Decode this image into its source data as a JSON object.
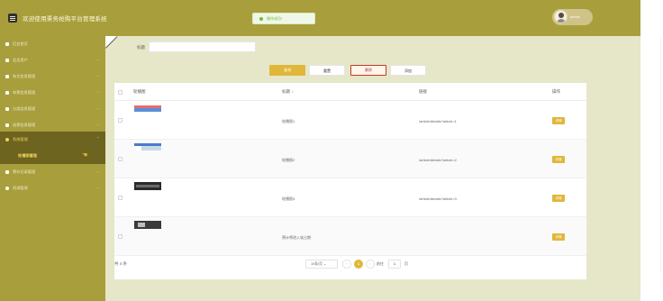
{
  "header": {
    "title": "欢迎使用票务抢购平台管理系统",
    "toast": "操作成功!",
    "user": "admin"
  },
  "sidebar": {
    "items": [
      {
        "label": "后台首页"
      },
      {
        "label": "会员用户"
      },
      {
        "label": "车次信息管理"
      },
      {
        "label": "车票信息管理"
      },
      {
        "label": "分类信息管理"
      },
      {
        "label": "退票信息管理"
      },
      {
        "label": "系统管理"
      },
      {
        "label": "轮播图管理"
      },
      {
        "label": "票价记录管理"
      },
      {
        "label": "资源管理"
      }
    ]
  },
  "search": {
    "label": "标题",
    "placeholder": ""
  },
  "toolbar": {
    "query": "查询",
    "reset": "重置",
    "delete": "删除",
    "add": "添加"
  },
  "table": {
    "columns": [
      "轮播图",
      "标题",
      "链接",
      "操作"
    ],
    "sort_icon": "≡",
    "rows": [
      {
        "title": "轮播图1",
        "link": "/article/details?article=1",
        "action": "详情"
      },
      {
        "title": "轮播图2",
        "link": "/article/details?article=2",
        "action": "详情"
      },
      {
        "title": "轮播图3",
        "link": "/article/details?article=3",
        "action": "详情"
      },
      {
        "title": "预计将进入攻占期",
        "link": "",
        "action": "详情"
      }
    ]
  },
  "pagination": {
    "total": "共 4 条",
    "page_size": "10条/页",
    "current_page": "1",
    "goto_label": "前往",
    "goto_value": "1",
    "goto_suffix": "页"
  },
  "colors": {
    "sidebar": "#a99e3c",
    "accent": "#e0b73a",
    "content_bg": "#e6e7c8"
  }
}
